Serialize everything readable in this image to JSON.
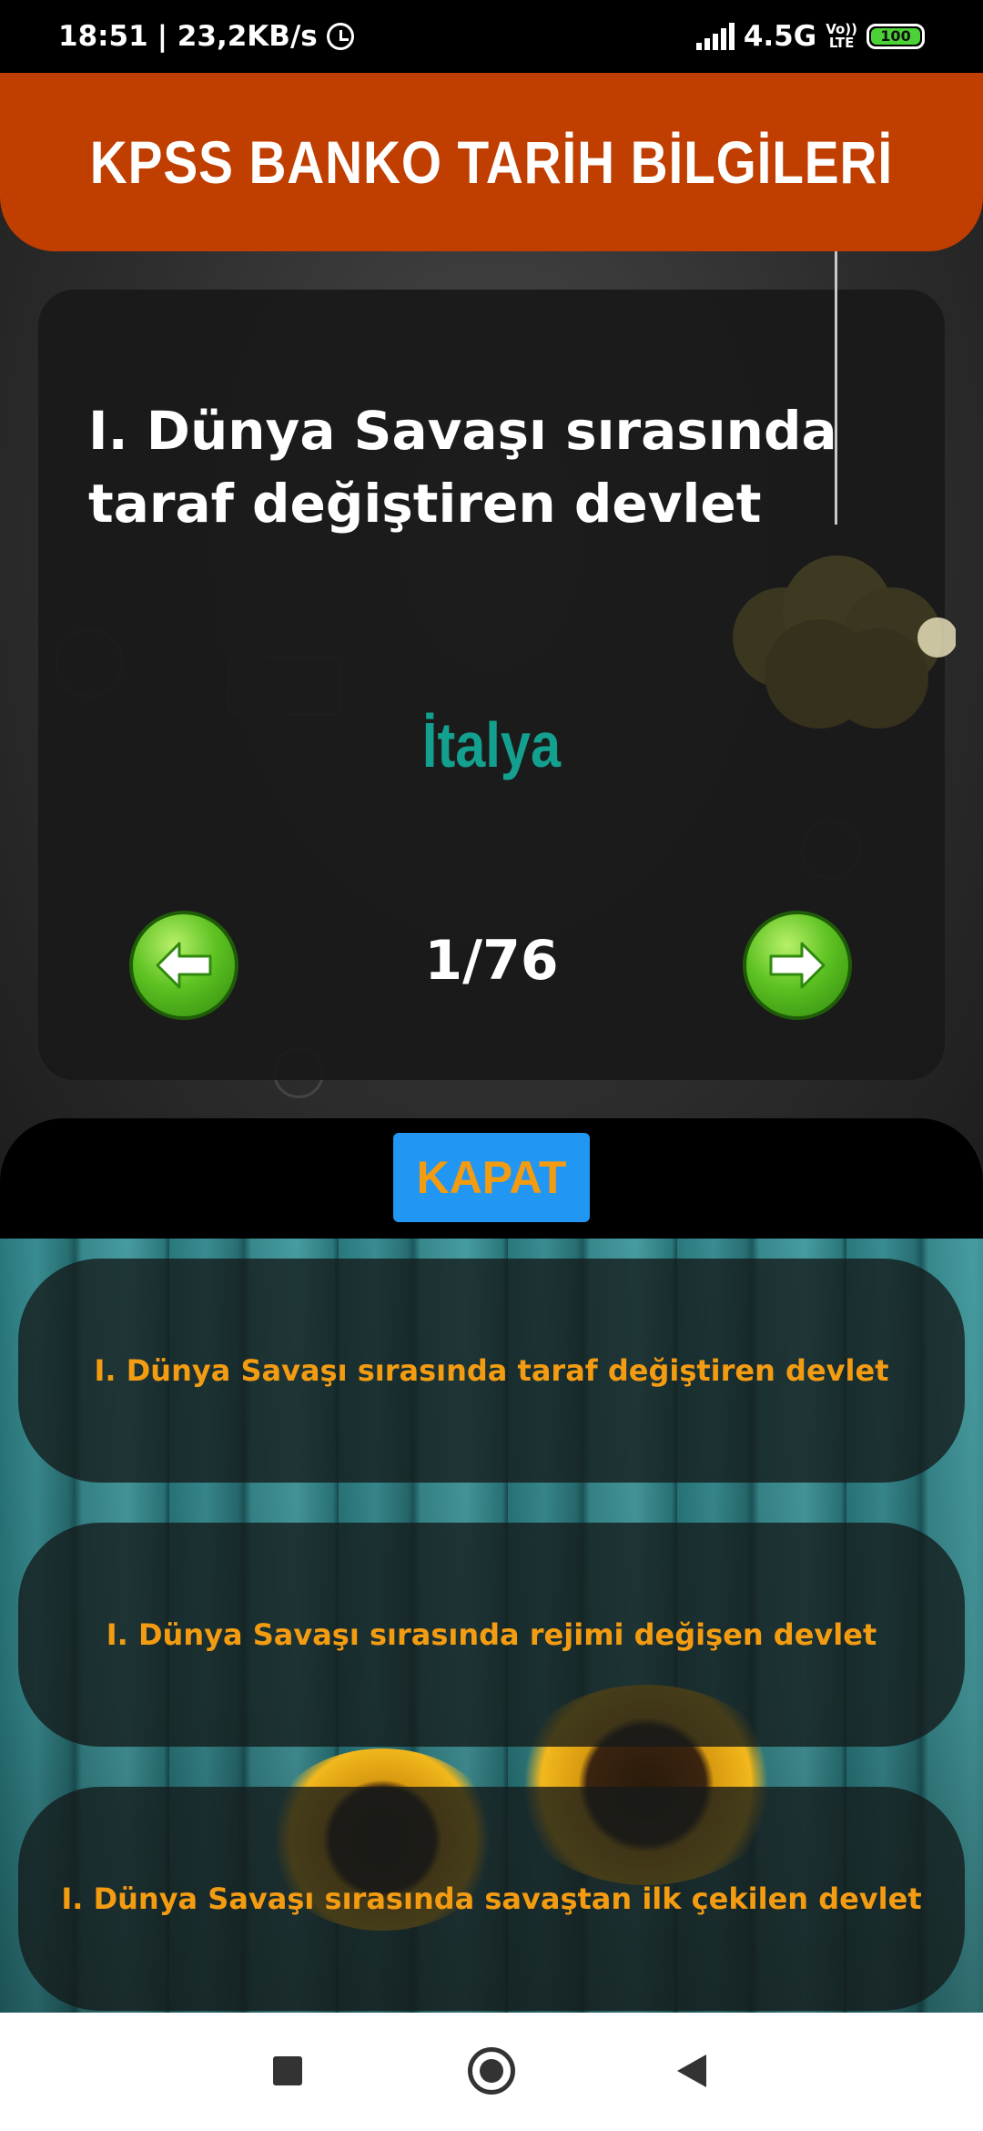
{
  "status_bar": {
    "time": "18:51",
    "network_speed": "| 23,2KB/s",
    "network_type": "4.5G",
    "volte_line1": "Vo))",
    "volte_line2": "LTE",
    "battery": "100",
    "icons": [
      "alarm-icon",
      "signal-icon",
      "volte-icon",
      "battery-icon"
    ]
  },
  "header": {
    "title": "KPSS BANKO TARİH BİLGİLERİ",
    "color": "#c03e00"
  },
  "card": {
    "question": "I. Dünya Savaşı sırasında taraf değiştiren devlet",
    "answer": "İtalya",
    "answer_color": "#14a08f",
    "counter": "1/76",
    "prev_icon": "arrow-left-icon",
    "next_icon": "arrow-right-icon"
  },
  "close": {
    "label": "KAPAT",
    "button_color": "#2196f3",
    "text_color": "#f39c12"
  },
  "list": {
    "items": [
      {
        "label": "I. Dünya Savaşı sırasında taraf değiştiren devlet"
      },
      {
        "label": "I. Dünya Savaşı sırasında rejimi değişen devlet"
      },
      {
        "label": "I. Dünya Savaşı sırasında savaştan ilk çekilen devlet"
      }
    ],
    "text_color": "#f39c12"
  },
  "nav_bar": {
    "icons": [
      "recents-icon",
      "home-icon",
      "back-icon"
    ]
  }
}
